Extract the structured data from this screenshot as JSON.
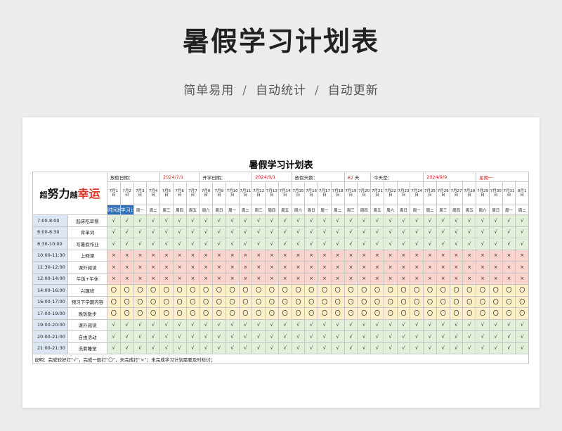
{
  "header": {
    "title": "暑假学习计划表",
    "subtitle_parts": [
      "简单易用",
      "自动统计",
      "自动更新"
    ],
    "separator": "/"
  },
  "sheet": {
    "title": "暑假学习计划表",
    "logo": {
      "line1": "超",
      "line2": "努力",
      "line3": "越",
      "line4": "幸运"
    },
    "info": {
      "start_label": "放假日期：",
      "start_value": "2024/7/1",
      "school_label": "开学日期：",
      "school_value": "2024/9/1",
      "days_label": "放假天数：",
      "days_value": "62",
      "days_unit": "天",
      "today_label": "今天是：",
      "today_value": "2024/9/9",
      "today_weekday": "星期一"
    },
    "col_headers": {
      "time": "时间段",
      "plan": "学习计划"
    },
    "dates": [
      "7月1日",
      "7月2日",
      "7月3日",
      "7月4日",
      "7月5日",
      "7月6日",
      "7月7日",
      "7月8日",
      "7月9日",
      "7月10日",
      "7月11日",
      "7月12日",
      "7月13日",
      "7月14日",
      "7月15日",
      "7月16日",
      "7月17日",
      "7月18日",
      "7月19日",
      "7月20日",
      "7月21日",
      "7月22日",
      "7月23日",
      "7月24日",
      "7月25日",
      "7月26日",
      "7月27日",
      "7月28日",
      "7月29日",
      "7月30日",
      "7月31日",
      "8月1日"
    ],
    "weekdays": [
      "周一",
      "周二",
      "周三",
      "周四",
      "周五",
      "周六",
      "周日",
      "周一",
      "周二",
      "周三",
      "周四",
      "周五",
      "周六",
      "周日",
      "周一",
      "周二",
      "周三",
      "周四",
      "周五",
      "周六",
      "周日",
      "周一",
      "周二",
      "周三",
      "周四",
      "周五",
      "周六",
      "周日",
      "周一",
      "周二",
      "周三",
      "周四"
    ],
    "rows": [
      {
        "time": "7:00-8:00",
        "plan": "起床吃早餐",
        "mark": "√",
        "kind": "green"
      },
      {
        "time": "8:00-8:30",
        "plan": "背单词",
        "mark": "√",
        "kind": "green"
      },
      {
        "time": "8:30-10:00",
        "plan": "写暑假作业",
        "mark": "√",
        "kind": "green"
      },
      {
        "time": "10:00-11:30",
        "plan": "上网课",
        "mark": "×",
        "kind": "red"
      },
      {
        "time": "11:30-12:00",
        "plan": "课外阅读",
        "mark": "×",
        "kind": "red"
      },
      {
        "time": "12:00-14:00",
        "plan": "午饭+午休",
        "mark": "×",
        "kind": "red"
      },
      {
        "time": "14:00-16:00",
        "plan": "兴趣班",
        "mark": "〇",
        "kind": "yellow"
      },
      {
        "time": "16:00-17:00",
        "plan": "预习下学期内容",
        "mark": "〇",
        "kind": "yellow"
      },
      {
        "time": "17:00-19:00",
        "plan": "晚饭散步",
        "mark": "〇",
        "kind": "yellow"
      },
      {
        "time": "19:00-20:00",
        "plan": "课外阅读",
        "mark": "√",
        "kind": "green"
      },
      {
        "time": "20:00-21:00",
        "plan": "自由活动",
        "mark": "√",
        "kind": "green"
      },
      {
        "time": "21:00-21:30",
        "plan": "洗漱睡觉",
        "mark": "√",
        "kind": "green"
      }
    ],
    "note": "说明：完成较好打“√”，完成一般打“〇”，未完成打“×”；未完成学习计划需要及时检讨；"
  }
}
